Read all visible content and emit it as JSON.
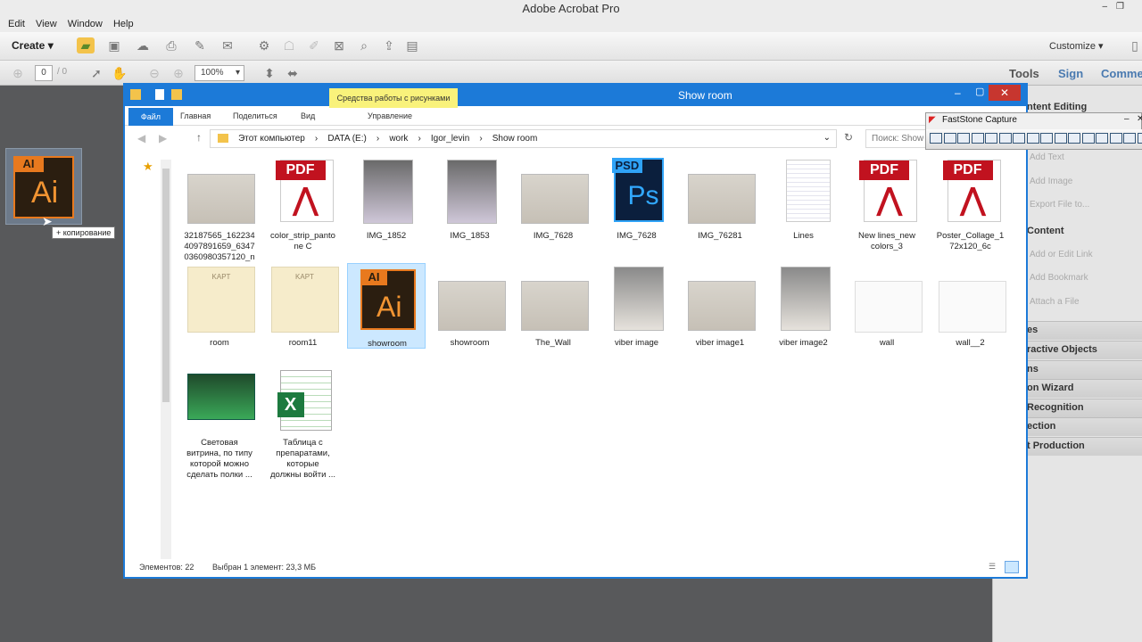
{
  "acrobat": {
    "title": "Adobe Acrobat Pro",
    "menu": [
      "Edit",
      "View",
      "Window",
      "Help"
    ],
    "create_label": "Create",
    "customize_label": "Customize",
    "page_current": "0",
    "page_total": "/ 0",
    "zoom": "100%",
    "tabs": {
      "tools": "Tools",
      "sign": "Sign",
      "comment": "Comme"
    },
    "panel": {
      "content_editing": "ntent Editing",
      "add_text": "Add Text",
      "add_image": "Add Image",
      "export_file": "Export File to...",
      "content_head": "Content",
      "add_link": "Add or Edit Link",
      "add_bookmark": "Add Bookmark",
      "attach_file": "Attach a File",
      "bars": [
        "es",
        "ractive Objects",
        "ns",
        "on Wizard",
        "Recognition",
        "ection",
        "t Production"
      ]
    }
  },
  "desktop": {
    "ai_tag": "AI",
    "ai_big": "Ai",
    "copy_tip": "+ копирование"
  },
  "explorer": {
    "title": "Show room",
    "context_tab": "Средства работы с рисунками",
    "tabs": {
      "file": "Файл",
      "home": "Главная",
      "share": "Поделиться",
      "view": "Вид",
      "manage": "Управление"
    },
    "breadcrumbs": [
      "Этот компьютер",
      "DATA (E:)",
      "work",
      "Igor_levin",
      "Show room"
    ],
    "search_placeholder": "Поиск: Show",
    "items": [
      {
        "name": "32187565_162234\n4097891659_6347\n0360980357120_n",
        "kind": "photo"
      },
      {
        "name": "color_strip_panto\nne C",
        "kind": "pdf"
      },
      {
        "name": "IMG_1852",
        "kind": "photo"
      },
      {
        "name": "IMG_1853",
        "kind": "photo"
      },
      {
        "name": "IMG_7628",
        "kind": "photo"
      },
      {
        "name": "IMG_7628",
        "kind": "psd"
      },
      {
        "name": "IMG_76281",
        "kind": "photo"
      },
      {
        "name": "Lines",
        "kind": "doc"
      },
      {
        "name": "New lines_new\ncolors_3",
        "kind": "pdf"
      },
      {
        "name": "Poster_Collage_1\n72x120_6c",
        "kind": "pdf"
      },
      {
        "name": "room",
        "kind": "sketch"
      },
      {
        "name": "room11",
        "kind": "sketch"
      },
      {
        "name": "showroom",
        "kind": "ai"
      },
      {
        "name": "showroom",
        "kind": "photo"
      },
      {
        "name": "The_Wall",
        "kind": "photo"
      },
      {
        "name": "viber image",
        "kind": "photo"
      },
      {
        "name": "viber image1",
        "kind": "photo"
      },
      {
        "name": "viber image2",
        "kind": "photo"
      },
      {
        "name": "wall",
        "kind": "diagram"
      },
      {
        "name": "wall__2",
        "kind": "diagram"
      },
      {
        "name": "Световая\nвитрина, по типу\nкоторой можно\nсделать полки ...",
        "kind": "green"
      },
      {
        "name": "Таблица с\nпрепаратами,\nкоторые\nдолжны войти ...",
        "kind": "excel"
      }
    ],
    "status_count": "Элементов: 22",
    "status_selected": "Выбран 1 элемент: 23,3 МБ",
    "psd_tag": "PSD",
    "psd_big": "Ps",
    "pdf_tag": "PDF",
    "sketch_text": "KAPT"
  },
  "faststone": {
    "title": "FastStone Capture"
  },
  "colors": {
    "accent": "#1c7ad8",
    "close": "#c7362f",
    "selection": "#cce8ff",
    "pdf_red": "#c1121f",
    "ai_orange": "#e8791e"
  }
}
